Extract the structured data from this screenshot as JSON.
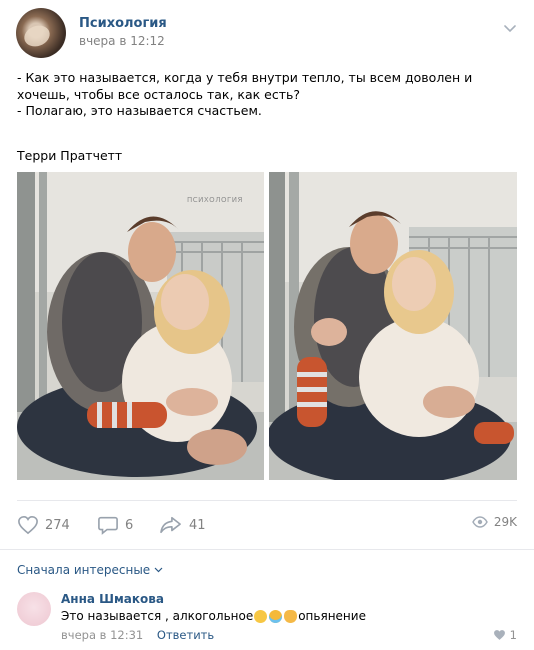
{
  "post": {
    "author": "Психология",
    "time": "вчера в 12:12",
    "text_lines": [
      "- Как это называется, когда у тебя внутри тепло, ты всем доволен и хочешь, чтобы все осталось так, как есть?",
      "- Полагаю, это называется счастьем."
    ],
    "quote_author": "Терри Пратчетт",
    "photo_watermark": "ПСИХОЛОГИЯ"
  },
  "actions": {
    "likes": "274",
    "comments": "6",
    "shares": "41",
    "views": "29K"
  },
  "comments_section": {
    "sort_label": "Сначала интересные",
    "comment": {
      "author": "Анна Шмакова",
      "text_before": "Это называется , алкогольное",
      "text_after": " опьянение",
      "time": "вчера в 12:31",
      "reply_label": "Ответить",
      "likes": "1"
    }
  },
  "colors": {
    "link": "#2a5885",
    "muted": "#828282",
    "divider": "#e7e8ec"
  }
}
